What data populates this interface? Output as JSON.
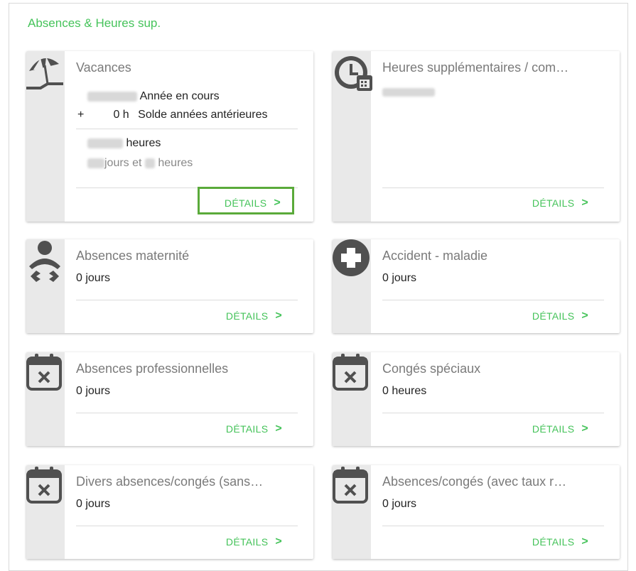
{
  "panel": {
    "title": "Absences & Heures sup."
  },
  "details_label": "DÉTAILS",
  "details_chevron": ">",
  "accent_color": "#45c35a",
  "focus_color": "#5aaa3a",
  "cards": {
    "vacances": {
      "title": "Vacances",
      "icon": "beach-umbrella-icon",
      "current_year_label": "Année en cours",
      "plus_sign": "+",
      "prior_years_value": "0 h",
      "prior_years_label": "Solde années antérieures",
      "total_unit": "heures",
      "days_label": "jours et",
      "hours_label": "heures"
    },
    "heures_sup": {
      "title": "Heures supplémentaires / com…",
      "icon": "clock-calendar-icon"
    },
    "maternite": {
      "title": "Absences maternité",
      "value": "0 jours",
      "icon": "baby-icon"
    },
    "accident": {
      "title": "Accident - maladie",
      "value": "0 jours",
      "icon": "medical-cross-icon"
    },
    "professionnelles": {
      "title": "Absences professionnelles",
      "value": "0 jours",
      "icon": "calendar-x-icon"
    },
    "conges_speciaux": {
      "title": "Congés spéciaux",
      "value": "0 heures",
      "icon": "calendar-x-icon"
    },
    "divers": {
      "title": "Divers absences/congés (sans…",
      "value": "0 jours",
      "icon": "calendar-x-icon"
    },
    "avec_taux": {
      "title": "Absences/congés (avec taux r…",
      "value": "0 jours",
      "icon": "calendar-x-icon"
    }
  }
}
